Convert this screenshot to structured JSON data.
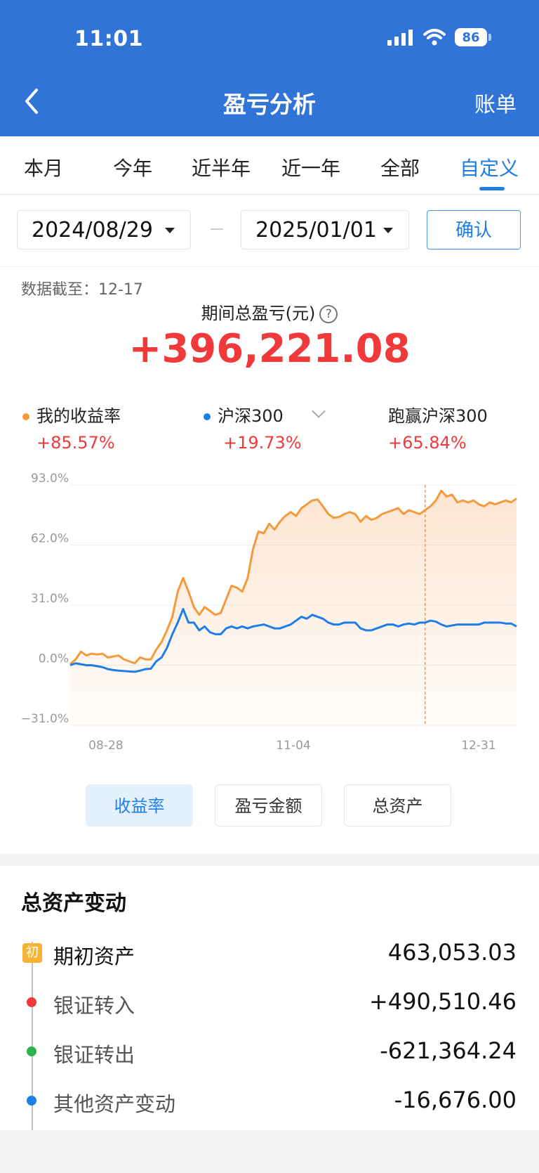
{
  "status_bar": {
    "time": "11:01",
    "battery": "86"
  },
  "nav": {
    "title": "盈亏分析",
    "right": "账单"
  },
  "tabs": [
    "本月",
    "今年",
    "近半年",
    "近一年",
    "全部",
    "自定义"
  ],
  "date_range": {
    "start": "2024/08/29",
    "end": "2025/01/01",
    "confirm": "确认"
  },
  "summary": {
    "as_of": "数据截至：12-17",
    "total_label": "期间总盈亏(元)",
    "help_icon": "?",
    "total_value": "+396,221.08"
  },
  "stats": [
    {
      "label": "我的收益率",
      "value": "+85.57%",
      "color": "#f59a3c"
    },
    {
      "label": "沪深300",
      "value": "+19.73%",
      "color": "#1f7ee6"
    },
    {
      "label": "跑赢沪深300",
      "value": "+65.84%"
    }
  ],
  "chart_data": {
    "type": "line",
    "y_ticks": [
      "93.0%",
      "62.0%",
      "31.0%",
      "0.0%",
      "−31.0%"
    ],
    "ylim": [
      -31,
      93
    ],
    "x_ticks": [
      "08-28",
      "11-04",
      "12-31"
    ],
    "series": [
      {
        "name": "我的收益率",
        "color": "#f59a3c",
        "values": [
          0.5,
          3,
          7,
          5,
          6,
          5.5,
          6,
          4,
          4.5,
          5,
          3,
          2,
          1,
          4,
          3,
          3,
          8,
          12,
          18,
          25,
          38,
          45,
          38,
          30,
          26,
          30,
          28,
          26,
          27,
          34,
          41,
          40,
          38,
          45,
          60,
          69,
          68,
          73,
          70,
          74,
          77,
          79,
          77,
          81,
          83,
          85,
          85.5,
          82,
          78,
          76,
          76.5,
          78,
          79,
          78,
          74,
          77,
          75,
          76,
          78,
          79,
          80,
          81,
          78,
          80,
          79,
          78,
          80,
          82,
          85,
          90,
          87,
          88,
          84,
          85,
          84,
          85,
          83,
          82,
          84,
          83,
          84,
          85,
          84,
          86
        ]
      },
      {
        "name": "沪深300",
        "color": "#1f7ee6",
        "values": [
          0,
          1,
          0.5,
          0,
          0,
          -0.5,
          -1,
          -2,
          -2.5,
          -2.8,
          -3,
          -3.2,
          -3.4,
          -2.8,
          -2,
          -1.8,
          2,
          4,
          9,
          16,
          22,
          29,
          22,
          22,
          18,
          20,
          17,
          16,
          16,
          19,
          20,
          19,
          20,
          19,
          20,
          20.5,
          21,
          20,
          19,
          19,
          20,
          21,
          23,
          25,
          24,
          26,
          25,
          24,
          22,
          21,
          21,
          22,
          22,
          22,
          19,
          18,
          18,
          19,
          20,
          21,
          21,
          20,
          21,
          21.5,
          21,
          22,
          22,
          23,
          22.5,
          21,
          20,
          20.5,
          21,
          21,
          21,
          21,
          21,
          22,
          22,
          22,
          22,
          21.5,
          21.5,
          20
        ]
      }
    ],
    "marker_date_index": 66
  },
  "chart_buttons": [
    "收益率",
    "盈亏金额",
    "总资产"
  ],
  "assets": {
    "title": "总资产变动",
    "badge": "初",
    "rows": [
      {
        "label": "期初资产",
        "value": "463,053.03",
        "color": "#f7b332"
      },
      {
        "label": "银证转入",
        "value": "+490,510.46",
        "color": "#f0393a"
      },
      {
        "label": "银证转出",
        "value": "-621,364.24",
        "color": "#2fb24a"
      },
      {
        "label": "其他资产变动",
        "value": "-16,676.00",
        "color": "#1f7ee6"
      }
    ]
  }
}
